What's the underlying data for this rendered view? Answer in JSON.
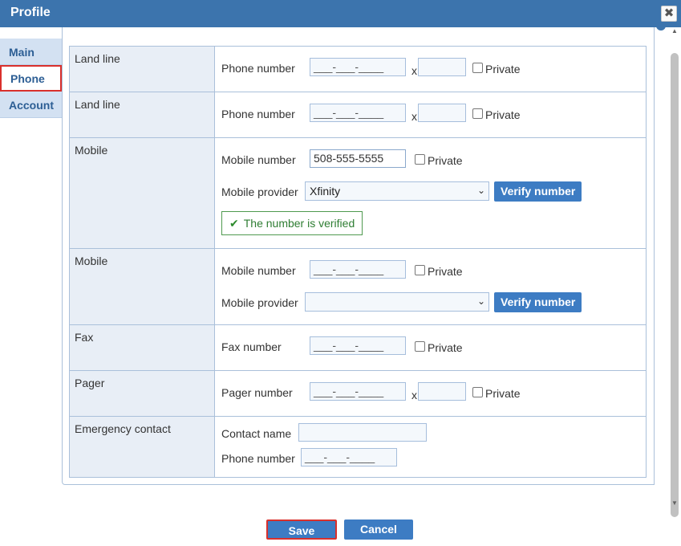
{
  "window": {
    "title": "Profile",
    "close_glyph": "✖"
  },
  "sidebar": {
    "items": [
      {
        "label": "Main"
      },
      {
        "label": "Phone"
      },
      {
        "label": "Account"
      }
    ]
  },
  "rows": {
    "landline1": {
      "label": "Land line",
      "field_label": "Phone number",
      "value": "___-___-____",
      "ext_prefix": "x",
      "ext_value": "",
      "private_label": "Private"
    },
    "landline2": {
      "label": "Land line",
      "field_label": "Phone number",
      "value": "___-___-____",
      "ext_prefix": "x",
      "ext_value": "",
      "private_label": "Private"
    },
    "mobile1": {
      "label": "Mobile",
      "field_label": "Mobile number",
      "value": "508-555-5555",
      "private_label": "Private",
      "provider_label": "Mobile provider",
      "provider_value": "Xfinity",
      "verify_label": "Verify number",
      "verified_text": "The number is verified"
    },
    "mobile2": {
      "label": "Mobile",
      "field_label": "Mobile number",
      "value": "___-___-____",
      "private_label": "Private",
      "provider_label": "Mobile provider",
      "provider_value": "",
      "verify_label": "Verify number"
    },
    "fax": {
      "label": "Fax",
      "field_label": "Fax number",
      "value": "___-___-____",
      "private_label": "Private"
    },
    "pager": {
      "label": "Pager",
      "field_label": "Pager number",
      "value": "___-___-____",
      "ext_prefix": "x",
      "ext_value": "",
      "private_label": "Private"
    },
    "emergency": {
      "label": "Emergency contact",
      "name_label": "Contact name",
      "name_value": "",
      "phone_label": "Phone number",
      "phone_value": "___-___-____"
    }
  },
  "footer": {
    "save_label": "Save",
    "cancel_label": "Cancel"
  },
  "colors": {
    "title_bar": "#3c74ad",
    "button": "#3d7cc3",
    "highlight": "#d9302c",
    "verified": "#2e7d32"
  },
  "icons": {
    "check": "checkmark-icon",
    "chevron": "chevron-down-icon",
    "close": "close-icon"
  }
}
